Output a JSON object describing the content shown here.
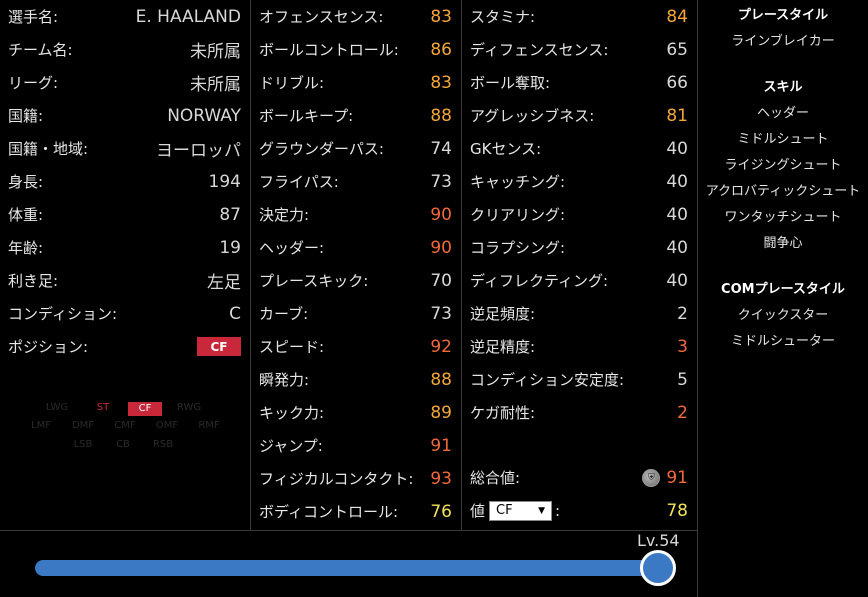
{
  "profile": [
    {
      "label": "選手名:",
      "value": "E. HAALAND"
    },
    {
      "label": "チーム名:",
      "value": "未所属"
    },
    {
      "label": "リーグ:",
      "value": "未所属"
    },
    {
      "label": "国籍:",
      "value": "NORWAY"
    },
    {
      "label": "国籍・地域:",
      "value": "ヨーロッパ"
    },
    {
      "label": "身長:",
      "value": "194"
    },
    {
      "label": "体重:",
      "value": "87"
    },
    {
      "label": "年齢:",
      "value": "19"
    },
    {
      "label": "利き足:",
      "value": "左足"
    },
    {
      "label": "コンディション:",
      "value": "C"
    },
    {
      "label": "ポジション:",
      "value": "CF"
    }
  ],
  "position_map": {
    "row1": [
      "LWG",
      "ST",
      "CF",
      "RWG"
    ],
    "row2": [
      "LMF",
      "DMF",
      "CMF",
      "OMF",
      "RMF"
    ],
    "row3": [
      "LSB",
      "CB",
      "RSB"
    ]
  },
  "stats_mid": [
    {
      "label": "オフェンスセンス:",
      "value": "83",
      "color": "orange"
    },
    {
      "label": "ボールコントロール:",
      "value": "86",
      "color": "orange"
    },
    {
      "label": "ドリブル:",
      "value": "83",
      "color": "orange"
    },
    {
      "label": "ボールキープ:",
      "value": "88",
      "color": "orange"
    },
    {
      "label": "グラウンダーパス:",
      "value": "74",
      "color": "white"
    },
    {
      "label": "フライパス:",
      "value": "73",
      "color": "white"
    },
    {
      "label": "決定力:",
      "value": "90",
      "color": "red"
    },
    {
      "label": "ヘッダー:",
      "value": "90",
      "color": "red"
    },
    {
      "label": "プレースキック:",
      "value": "70",
      "color": "white"
    },
    {
      "label": "カーブ:",
      "value": "73",
      "color": "white"
    },
    {
      "label": "スピード:",
      "value": "92",
      "color": "red"
    },
    {
      "label": "瞬発力:",
      "value": "88",
      "color": "orange"
    },
    {
      "label": "キック力:",
      "value": "89",
      "color": "orange"
    },
    {
      "label": "ジャンプ:",
      "value": "91",
      "color": "red"
    },
    {
      "label": "フィジカルコンタクト:",
      "value": "93",
      "color": "red"
    },
    {
      "label": "ボディコントロール:",
      "value": "76",
      "color": "yellow"
    }
  ],
  "stats_right": [
    {
      "label": "スタミナ:",
      "value": "84",
      "color": "orange"
    },
    {
      "label": "ディフェンスセンス:",
      "value": "65",
      "color": "white"
    },
    {
      "label": "ボール奪取:",
      "value": "66",
      "color": "white"
    },
    {
      "label": "アグレッシブネス:",
      "value": "81",
      "color": "orange"
    },
    {
      "label": "GKセンス:",
      "value": "40",
      "color": "white"
    },
    {
      "label": "キャッチング:",
      "value": "40",
      "color": "white"
    },
    {
      "label": "クリアリング:",
      "value": "40",
      "color": "white"
    },
    {
      "label": "コラプシング:",
      "value": "40",
      "color": "white"
    },
    {
      "label": "ディフレクティング:",
      "value": "40",
      "color": "white"
    },
    {
      "label": "逆足頻度:",
      "value": "2",
      "color": "white"
    },
    {
      "label": "逆足精度:",
      "value": "3",
      "color": "red"
    },
    {
      "label": "コンディション安定度:",
      "value": "5",
      "color": "white"
    },
    {
      "label": "ケガ耐性:",
      "value": "2",
      "color": "red"
    }
  ],
  "overall": {
    "label": "総合値:",
    "value": "91"
  },
  "pos_value": {
    "label_prefix": "値",
    "label_suffix": ":",
    "select": "CF",
    "value": "78"
  },
  "sidebar": {
    "playstyle_title": "プレースタイル",
    "playstyle": "ラインブレイカー",
    "skills_title": "スキル",
    "skills": [
      "ヘッダー",
      "ミドルシュート",
      "ライジングシュート",
      "アクロバティックシュート",
      "ワンタッチシュート",
      "闘争心"
    ],
    "com_title": "COMプレースタイル",
    "com": [
      "クイックスター",
      "ミドルシューター"
    ]
  },
  "level": {
    "label": "Lv.54",
    "fraction": 1.0
  },
  "colors": {
    "orange": "#f4a63a",
    "red": "#f26a3a",
    "yellow": "#f3e15a",
    "white": "#d8d8d8",
    "accent": "#3b79c5",
    "badge": "#c8283a"
  }
}
